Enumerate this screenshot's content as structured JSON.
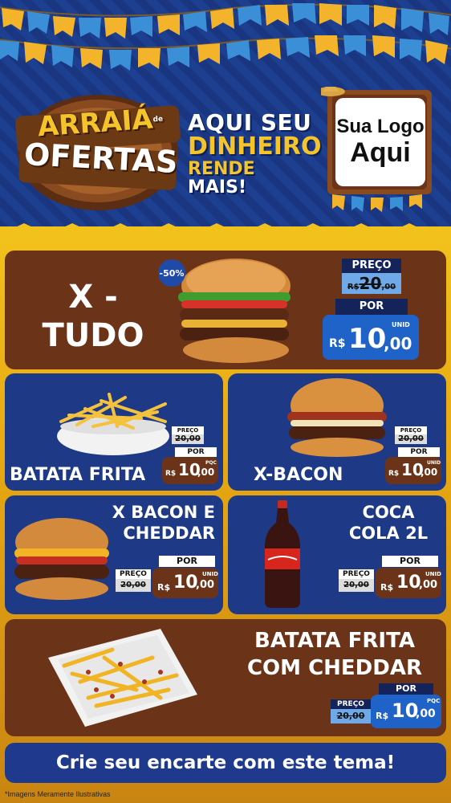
{
  "header": {
    "event_logo": {
      "line1": "ARRAIÁ",
      "small": "de",
      "line2": "OFERTAS"
    },
    "tagline": {
      "line1": "AQUI SEU",
      "line2": "DINHEIRO",
      "line3_a": "RENDE",
      "line3_b": "MAIS!"
    },
    "your_logo": {
      "line1": "Sua Logo",
      "line2": "Aqui"
    }
  },
  "products": {
    "x_tudo": {
      "title_line1": "X -",
      "title_line2": "TUDO",
      "discount_badge": "-50%",
      "old_label": "PREÇO",
      "old_price_prefix": "R$",
      "old_price": "20",
      "old_price_cents": ",00",
      "new_label": "POR",
      "unit": "UNID",
      "new_price_prefix": "R$",
      "new_price": "10",
      "new_price_cents": ",00"
    },
    "batata_frita": {
      "title": "BATATA FRITA",
      "old_label": "PREÇO",
      "old_price": "20,00",
      "new_label": "POR",
      "unit": "PQC",
      "new_price_prefix": "R$",
      "new_price": "10",
      "new_price_cents": ",00"
    },
    "x_bacon": {
      "title": "X-BACON",
      "old_label": "PREÇO",
      "old_price": "20,00",
      "new_label": "POR",
      "unit": "UNID",
      "new_price_prefix": "R$",
      "new_price": "10",
      "new_price_cents": ",00"
    },
    "x_bacon_cheddar": {
      "title_line1": "X BACON E",
      "title_line2": "CHEDDAR",
      "old_label": "PREÇO",
      "old_price": "20,00",
      "new_label": "POR",
      "unit": "UNID",
      "new_price_prefix": "R$",
      "new_price": "10",
      "new_price_cents": ",00"
    },
    "coca_cola": {
      "title_line1": "COCA",
      "title_line2": "COLA 2L",
      "old_label": "PREÇO",
      "old_price": "20,00",
      "new_label": "POR",
      "unit": "UNID",
      "new_price_prefix": "R$",
      "new_price": "10",
      "new_price_cents": ",00"
    },
    "batata_cheddar": {
      "title_line1": "BATATA FRITA",
      "title_line2": "COM CHEDDAR",
      "old_label": "PREÇO",
      "old_price": "20,00",
      "new_label": "POR",
      "unit": "PQC",
      "new_price_prefix": "R$",
      "new_price": "10",
      "new_price_cents": ",00"
    }
  },
  "footer": {
    "cta": "Crie seu encarte com este tema!",
    "disclaimer": "*Imagens Meramente Ilustrativas"
  },
  "colors": {
    "brown_card": "#6b3419",
    "blue_card": "#1e3a87",
    "yellow": "#f2c21c",
    "price_blue": "#1f63c9",
    "price_red": "#c8281e"
  },
  "icons": [
    "burger-image",
    "fries-image",
    "bacon-burger-image",
    "cheddar-burger-image",
    "cola-bottle-image",
    "cheddar-fries-image"
  ]
}
